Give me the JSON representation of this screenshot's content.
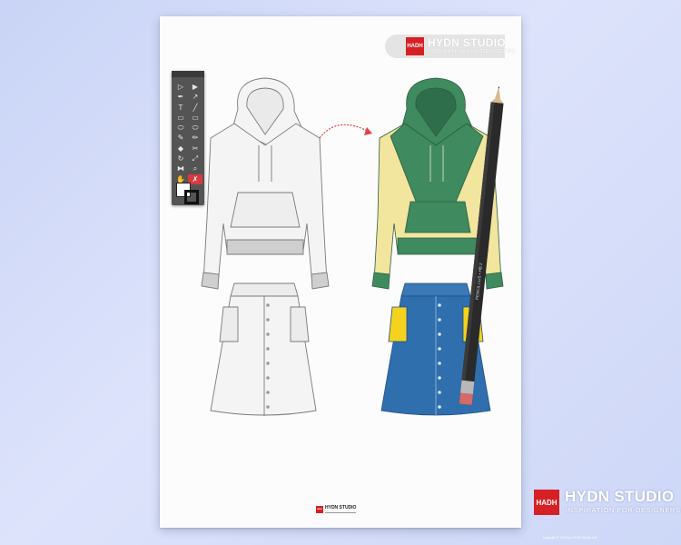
{
  "header": {
    "logo_text": "HADH",
    "title": "HYDN STUDIO",
    "subtitle": "INSPIRATION FOR DESIGNERS"
  },
  "footer": {
    "logo_text": "HADH",
    "title": "HYDN STUDIO"
  },
  "brand_watermark": {
    "logo_text": "HADH",
    "title": "HYDN STUDIO",
    "subtitle": "INSPIRATION FOR DESIGNERS",
    "micro_text": "",
    "copyright": "copyright © 2019 by HYDN Studio Ltd."
  },
  "toolbar": {
    "tools": [
      {
        "icon": "selection-tool-icon",
        "glyph": "▷"
      },
      {
        "icon": "direct-selection-tool-icon",
        "glyph": "▶"
      },
      {
        "icon": "pen-tool-icon",
        "glyph": "✒"
      },
      {
        "icon": "curvature-tool-icon",
        "glyph": "↗"
      },
      {
        "icon": "type-tool-icon",
        "glyph": "T"
      },
      {
        "icon": "line-tool-icon",
        "glyph": "╱"
      },
      {
        "icon": "rectangle-tool-icon",
        "glyph": "▭"
      },
      {
        "icon": "rectangle-alt-tool-icon",
        "glyph": "▭"
      },
      {
        "icon": "ellipse-tool-icon",
        "glyph": "⬭"
      },
      {
        "icon": "ellipse-alt-tool-icon",
        "glyph": "⬭"
      },
      {
        "icon": "paintbrush-tool-icon",
        "glyph": "✎"
      },
      {
        "icon": "pencil-tool-icon",
        "glyph": "✏"
      },
      {
        "icon": "eraser-tool-icon",
        "glyph": "◆"
      },
      {
        "icon": "scissors-tool-icon",
        "glyph": "✂"
      },
      {
        "icon": "rotate-tool-icon",
        "glyph": "↻"
      },
      {
        "icon": "scale-tool-icon",
        "glyph": "⤢"
      },
      {
        "icon": "width-tool-icon",
        "glyph": "⧓"
      },
      {
        "icon": "zoom-tool-icon",
        "glyph": "⌕"
      },
      {
        "icon": "hand-tool-icon",
        "glyph": "✋"
      },
      {
        "icon": "eyedropper-tool-icon",
        "glyph": "✗"
      }
    ],
    "active_tool": 19
  },
  "colors": {
    "background": "#cfd8f7",
    "paper": "#fcfcfc",
    "brand_red": "#d62024",
    "hoodie_green": "#3f8a5e",
    "hoodie_yellow": "#f2e59e",
    "skirt_denim": "#2f6fae",
    "pocket_yellow": "#f4d21e",
    "arrow_red": "#e04046"
  },
  "pencil": {
    "inscription": "PENCIL LLIS • HB 2"
  }
}
